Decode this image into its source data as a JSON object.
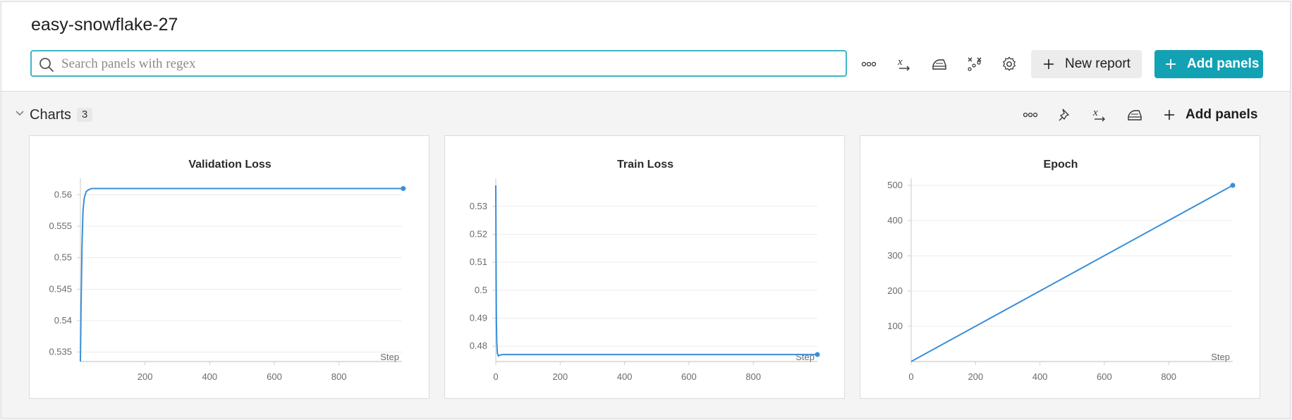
{
  "header": {
    "run_name": "easy-snowflake-27",
    "search_placeholder": "Search panels with regex",
    "new_report_label": "New report",
    "add_panels_label": "Add panels"
  },
  "toolbar_icons": [
    "more-icon",
    "x-axis-icon",
    "smoothing-icon",
    "outliers-icon",
    "settings-icon"
  ],
  "section": {
    "title": "Charts",
    "count": "3",
    "add_panels_label": "Add panels",
    "icons": [
      "more-icon",
      "pin-icon",
      "x-axis-icon",
      "smoothing-icon"
    ]
  },
  "colors": {
    "accent": "#13a1b4",
    "search_border": "#43b5c4",
    "series": "#3a8fd9"
  },
  "chart_data": [
    {
      "type": "line",
      "title": "Validation Loss",
      "xlabel": "Step",
      "xlim": [
        0,
        995
      ],
      "ylim": [
        0.5335,
        0.5615
      ],
      "xticks": [
        200,
        400,
        600,
        800
      ],
      "yticks": [
        0.535,
        0.54,
        0.545,
        0.55,
        0.555,
        0.56
      ],
      "ytick_labels": [
        "0.535",
        "0.54",
        "0.545",
        "0.55",
        "0.555",
        "0.56"
      ],
      "series": [
        {
          "x": [
            0,
            2,
            5,
            8,
            12,
            18,
            25,
            35,
            50,
            70,
            100,
            200,
            400,
            600,
            800,
            999
          ],
          "y": [
            0.5335,
            0.542,
            0.552,
            0.5575,
            0.5595,
            0.5605,
            0.5608,
            0.561,
            0.561,
            0.561,
            0.561,
            0.561,
            0.561,
            0.561,
            0.561,
            0.561
          ]
        }
      ]
    },
    {
      "type": "line",
      "title": "Train Loss",
      "xlabel": "Step",
      "xlim": [
        0,
        999
      ],
      "ylim": [
        0.4745,
        0.5375
      ],
      "xticks": [
        0,
        200,
        400,
        600,
        800
      ],
      "yticks": [
        0.48,
        0.49,
        0.5,
        0.51,
        0.52,
        0.53
      ],
      "ytick_labels": [
        "0.48",
        "0.49",
        "0.5",
        "0.51",
        "0.52",
        "0.53"
      ],
      "series": [
        {
          "x": [
            0,
            1,
            2,
            3,
            5,
            8,
            12,
            20,
            40,
            100,
            300,
            600,
            999
          ],
          "y": [
            0.5375,
            0.505,
            0.488,
            0.4815,
            0.4775,
            0.4765,
            0.4768,
            0.477,
            0.477,
            0.477,
            0.477,
            0.477,
            0.477
          ]
        }
      ]
    },
    {
      "type": "line",
      "title": "Epoch",
      "xlabel": "Step",
      "xlim": [
        0,
        999
      ],
      "ylim": [
        0,
        500
      ],
      "xticks": [
        0,
        200,
        400,
        600,
        800
      ],
      "yticks": [
        100,
        200,
        300,
        400,
        500
      ],
      "ytick_labels": [
        "100",
        "200",
        "300",
        "400",
        "500"
      ],
      "series": [
        {
          "x": [
            0,
            999
          ],
          "y": [
            0,
            500
          ]
        }
      ]
    }
  ]
}
